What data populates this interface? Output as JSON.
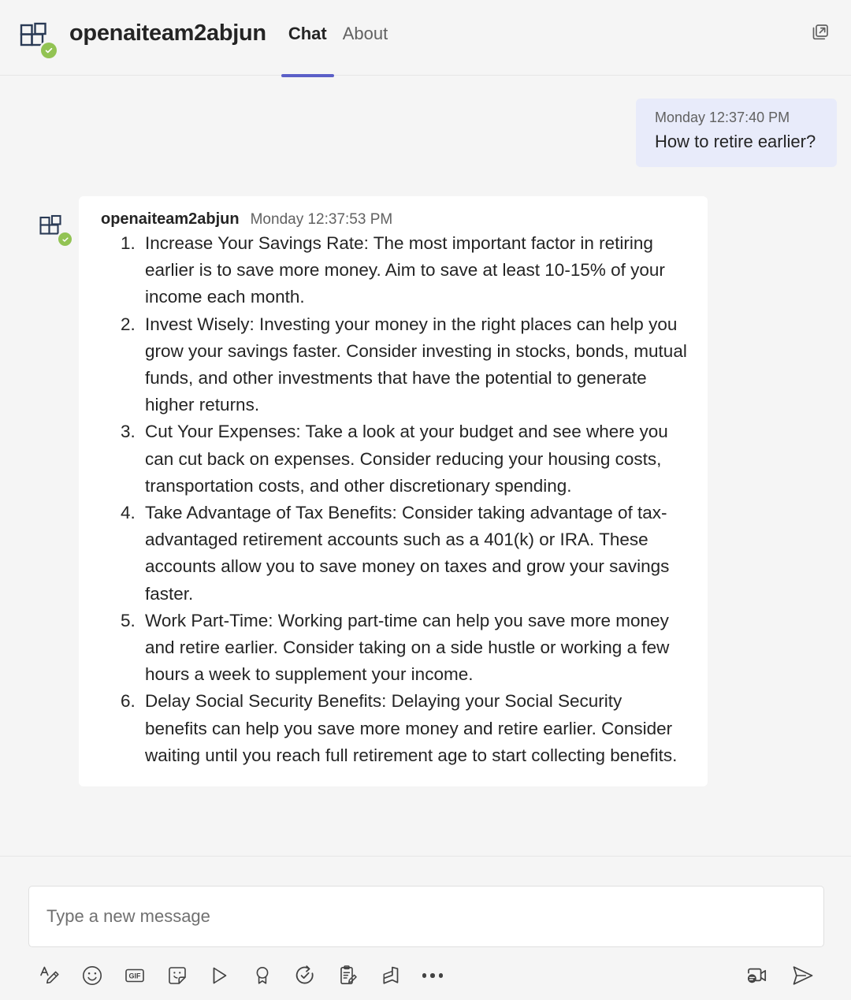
{
  "header": {
    "app_name": "openaiteam2abjun",
    "app_icon": "app-blocks-icon",
    "verified_badge": "verified-check-icon",
    "popout_icon": "open-in-new-window-icon",
    "tabs": [
      {
        "label": "Chat",
        "active": true
      },
      {
        "label": "About",
        "active": false
      }
    ],
    "accent_color": "#5b5fc7"
  },
  "conversation": {
    "outgoing": {
      "timestamp": "Monday 12:37:40 PM",
      "text": "How to retire earlier?",
      "bubble_color": "#e8ebfa"
    },
    "incoming": {
      "author": "openaiteam2abjun",
      "timestamp": "Monday 12:37:53 PM",
      "avatar_icon": "app-blocks-icon",
      "verified_badge": "verified-check-icon",
      "card_color": "#ffffff",
      "list_items": [
        "Increase Your Savings Rate: The most important factor in retiring earlier is to save more money. Aim to save at least 10-15% of your income each month.",
        "Invest Wisely: Investing your money in the right places can help you grow your savings faster. Consider investing in stocks, bonds, mutual funds, and other investments that have the potential to generate higher returns.",
        "Cut Your Expenses: Take a look at your budget and see where you can cut back on expenses. Consider reducing your housing costs, transportation costs, and other discretionary spending.",
        "Take Advantage of Tax Benefits: Consider taking advantage of tax-advantaged retirement accounts such as a 401(k) or IRA. These accounts allow you to save money on taxes and grow your savings faster.",
        "Work Part-Time: Working part-time can help you save more money and retire earlier. Consider taking on a side hustle or working a few hours a week to supplement your income.",
        "Delay Social Security Benefits: Delaying your Social Security benefits can help you save more money and retire earlier. Consider waiting until you reach full retirement age to start collecting benefits."
      ]
    }
  },
  "compose": {
    "placeholder": "Type a new message",
    "value": "",
    "tools_left": [
      {
        "name": "format-text-icon",
        "label": "Format"
      },
      {
        "name": "emoji-icon",
        "label": "Emoji"
      },
      {
        "name": "gif-icon",
        "label": "GIF"
      },
      {
        "name": "sticker-icon",
        "label": "Sticker"
      },
      {
        "name": "stream-icon",
        "label": "Stream"
      },
      {
        "name": "praise-icon",
        "label": "Praise"
      },
      {
        "name": "approvals-icon",
        "label": "Approvals"
      },
      {
        "name": "forms-icon",
        "label": "Forms"
      },
      {
        "name": "azure-devops-icon",
        "label": "Azure DevOps"
      },
      {
        "name": "more-options-icon",
        "label": "More options"
      }
    ],
    "tools_right": [
      {
        "name": "video-clip-icon",
        "label": "Record video clip"
      },
      {
        "name": "send-icon",
        "label": "Send"
      }
    ]
  }
}
